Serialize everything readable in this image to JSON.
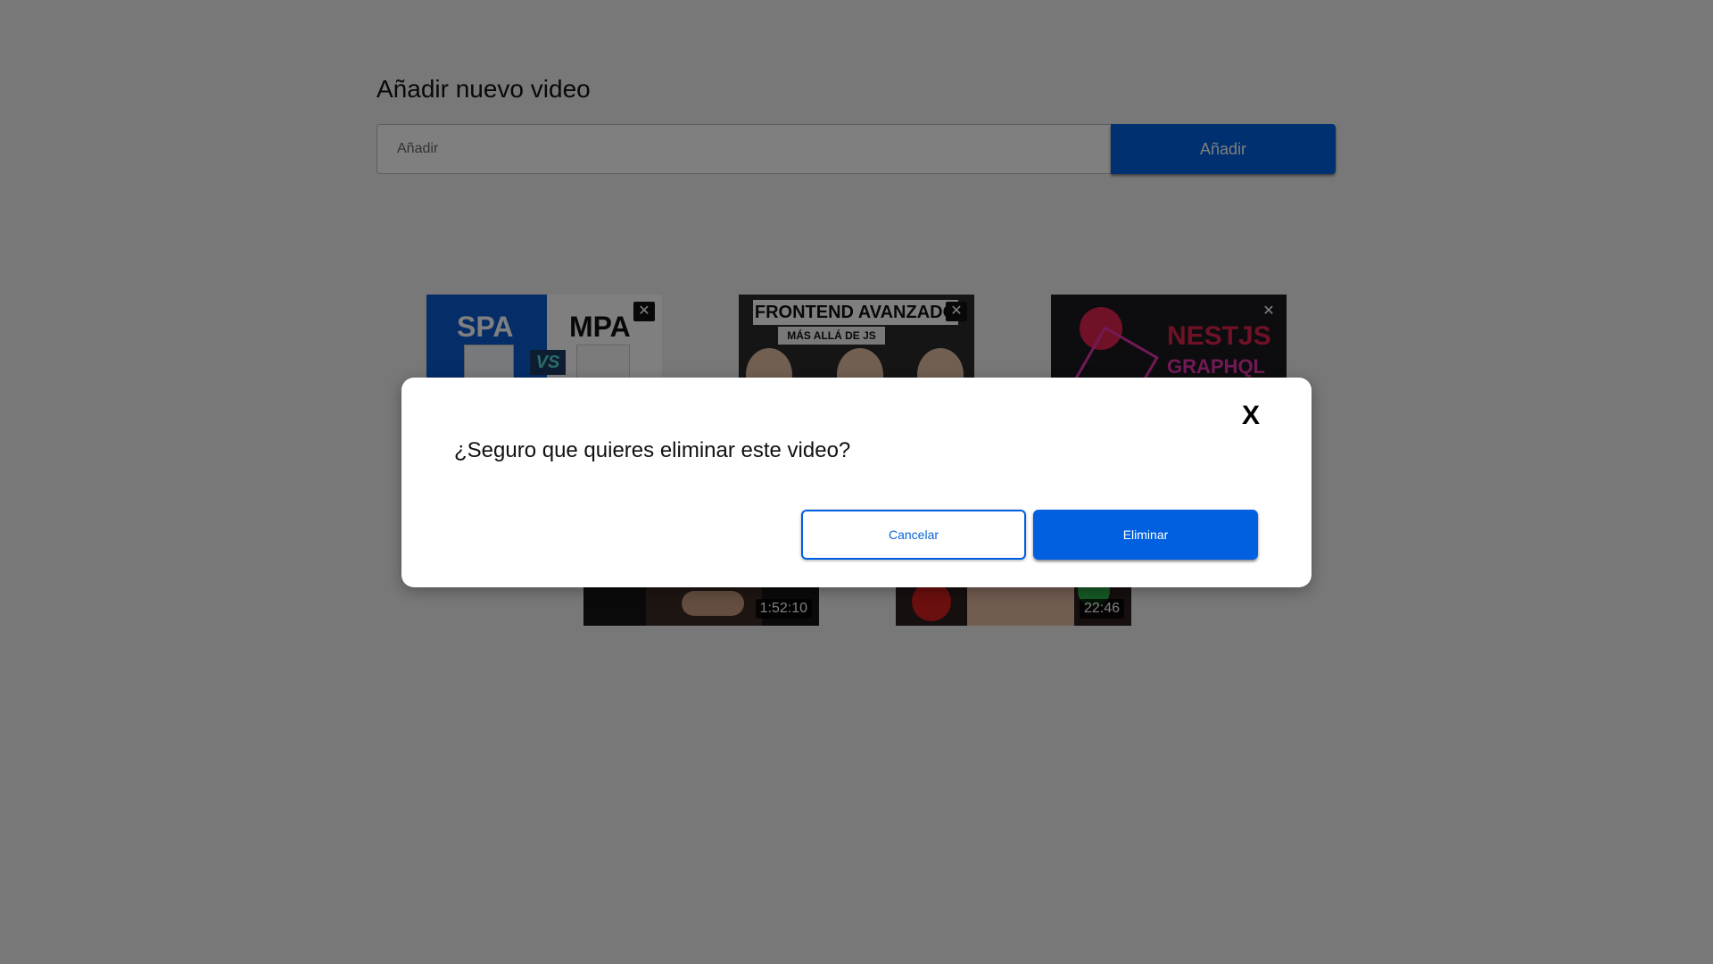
{
  "form": {
    "title": "Añadir nuevo video",
    "input_placeholder": "Añadir",
    "button_label": "Añadir"
  },
  "videos": [
    {
      "close_symbol": "✕",
      "thumbnail_text": [
        "SPA",
        "MPA",
        "VS"
      ],
      "duration": ""
    },
    {
      "close_symbol": "✕",
      "thumbnail_text": [
        "FRONTEND AVANZADO",
        "MÁS ALLÁ DE JS"
      ],
      "duration": ""
    },
    {
      "close_symbol": "✕",
      "thumbnail_text": [
        "NESTJS",
        "GRAPHQL"
      ],
      "duration": ""
    },
    {
      "close_symbol": "",
      "thumbnail_text": [],
      "duration": "1:52:10"
    },
    {
      "close_symbol": "",
      "thumbnail_text": [],
      "duration": "22:46"
    }
  ],
  "modal": {
    "message": "¿Seguro que quieres eliminar este video?",
    "close_label": "X",
    "cancel_label": "Cancelar",
    "delete_label": "Eliminar"
  },
  "colors": {
    "primary": "#0060df",
    "overlay": "rgba(0,0,0,0.5)",
    "page_background": "#f1f1f1"
  }
}
